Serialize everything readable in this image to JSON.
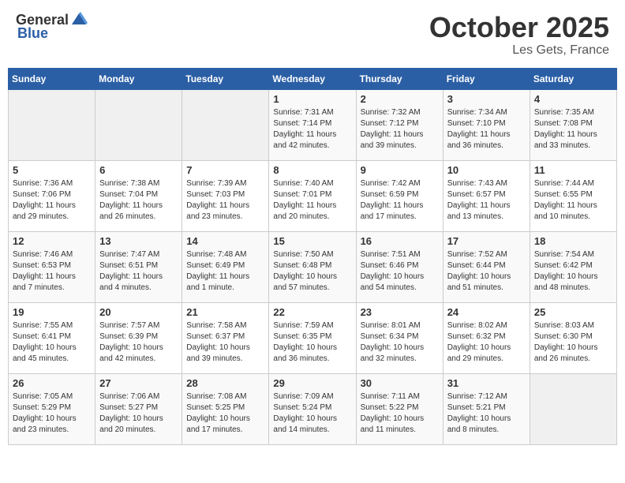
{
  "header": {
    "logo_general": "General",
    "logo_blue": "Blue",
    "month": "October 2025",
    "location": "Les Gets, France"
  },
  "days_of_week": [
    "Sunday",
    "Monday",
    "Tuesday",
    "Wednesday",
    "Thursday",
    "Friday",
    "Saturday"
  ],
  "weeks": [
    [
      {
        "day": "",
        "info": ""
      },
      {
        "day": "",
        "info": ""
      },
      {
        "day": "",
        "info": ""
      },
      {
        "day": "1",
        "info": "Sunrise: 7:31 AM\nSunset: 7:14 PM\nDaylight: 11 hours\nand 42 minutes."
      },
      {
        "day": "2",
        "info": "Sunrise: 7:32 AM\nSunset: 7:12 PM\nDaylight: 11 hours\nand 39 minutes."
      },
      {
        "day": "3",
        "info": "Sunrise: 7:34 AM\nSunset: 7:10 PM\nDaylight: 11 hours\nand 36 minutes."
      },
      {
        "day": "4",
        "info": "Sunrise: 7:35 AM\nSunset: 7:08 PM\nDaylight: 11 hours\nand 33 minutes."
      }
    ],
    [
      {
        "day": "5",
        "info": "Sunrise: 7:36 AM\nSunset: 7:06 PM\nDaylight: 11 hours\nand 29 minutes."
      },
      {
        "day": "6",
        "info": "Sunrise: 7:38 AM\nSunset: 7:04 PM\nDaylight: 11 hours\nand 26 minutes."
      },
      {
        "day": "7",
        "info": "Sunrise: 7:39 AM\nSunset: 7:03 PM\nDaylight: 11 hours\nand 23 minutes."
      },
      {
        "day": "8",
        "info": "Sunrise: 7:40 AM\nSunset: 7:01 PM\nDaylight: 11 hours\nand 20 minutes."
      },
      {
        "day": "9",
        "info": "Sunrise: 7:42 AM\nSunset: 6:59 PM\nDaylight: 11 hours\nand 17 minutes."
      },
      {
        "day": "10",
        "info": "Sunrise: 7:43 AM\nSunset: 6:57 PM\nDaylight: 11 hours\nand 13 minutes."
      },
      {
        "day": "11",
        "info": "Sunrise: 7:44 AM\nSunset: 6:55 PM\nDaylight: 11 hours\nand 10 minutes."
      }
    ],
    [
      {
        "day": "12",
        "info": "Sunrise: 7:46 AM\nSunset: 6:53 PM\nDaylight: 11 hours\nand 7 minutes."
      },
      {
        "day": "13",
        "info": "Sunrise: 7:47 AM\nSunset: 6:51 PM\nDaylight: 11 hours\nand 4 minutes."
      },
      {
        "day": "14",
        "info": "Sunrise: 7:48 AM\nSunset: 6:49 PM\nDaylight: 11 hours\nand 1 minute."
      },
      {
        "day": "15",
        "info": "Sunrise: 7:50 AM\nSunset: 6:48 PM\nDaylight: 10 hours\nand 57 minutes."
      },
      {
        "day": "16",
        "info": "Sunrise: 7:51 AM\nSunset: 6:46 PM\nDaylight: 10 hours\nand 54 minutes."
      },
      {
        "day": "17",
        "info": "Sunrise: 7:52 AM\nSunset: 6:44 PM\nDaylight: 10 hours\nand 51 minutes."
      },
      {
        "day": "18",
        "info": "Sunrise: 7:54 AM\nSunset: 6:42 PM\nDaylight: 10 hours\nand 48 minutes."
      }
    ],
    [
      {
        "day": "19",
        "info": "Sunrise: 7:55 AM\nSunset: 6:41 PM\nDaylight: 10 hours\nand 45 minutes."
      },
      {
        "day": "20",
        "info": "Sunrise: 7:57 AM\nSunset: 6:39 PM\nDaylight: 10 hours\nand 42 minutes."
      },
      {
        "day": "21",
        "info": "Sunrise: 7:58 AM\nSunset: 6:37 PM\nDaylight: 10 hours\nand 39 minutes."
      },
      {
        "day": "22",
        "info": "Sunrise: 7:59 AM\nSunset: 6:35 PM\nDaylight: 10 hours\nand 36 minutes."
      },
      {
        "day": "23",
        "info": "Sunrise: 8:01 AM\nSunset: 6:34 PM\nDaylight: 10 hours\nand 32 minutes."
      },
      {
        "day": "24",
        "info": "Sunrise: 8:02 AM\nSunset: 6:32 PM\nDaylight: 10 hours\nand 29 minutes."
      },
      {
        "day": "25",
        "info": "Sunrise: 8:03 AM\nSunset: 6:30 PM\nDaylight: 10 hours\nand 26 minutes."
      }
    ],
    [
      {
        "day": "26",
        "info": "Sunrise: 7:05 AM\nSunset: 5:29 PM\nDaylight: 10 hours\nand 23 minutes."
      },
      {
        "day": "27",
        "info": "Sunrise: 7:06 AM\nSunset: 5:27 PM\nDaylight: 10 hours\nand 20 minutes."
      },
      {
        "day": "28",
        "info": "Sunrise: 7:08 AM\nSunset: 5:25 PM\nDaylight: 10 hours\nand 17 minutes."
      },
      {
        "day": "29",
        "info": "Sunrise: 7:09 AM\nSunset: 5:24 PM\nDaylight: 10 hours\nand 14 minutes."
      },
      {
        "day": "30",
        "info": "Sunrise: 7:11 AM\nSunset: 5:22 PM\nDaylight: 10 hours\nand 11 minutes."
      },
      {
        "day": "31",
        "info": "Sunrise: 7:12 AM\nSunset: 5:21 PM\nDaylight: 10 hours\nand 8 minutes."
      },
      {
        "day": "",
        "info": ""
      }
    ]
  ]
}
